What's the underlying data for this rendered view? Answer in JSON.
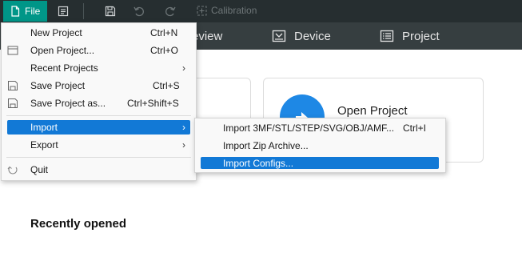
{
  "toolbar": {
    "file_label": "File",
    "calibration_label": "Calibration"
  },
  "tabs": [
    {
      "label": "eview"
    },
    {
      "label": "Device"
    },
    {
      "label": "Project"
    }
  ],
  "home": {
    "open_project_label": "Open Project",
    "recently_opened_label": "Recently opened"
  },
  "file_menu": {
    "items": [
      {
        "label": "New Project",
        "shortcut": "Ctrl+N"
      },
      {
        "label": "Open Project...",
        "shortcut": "Ctrl+O"
      },
      {
        "label": "Recent Projects",
        "shortcut": ""
      },
      {
        "label": "Save Project",
        "shortcut": "Ctrl+S"
      },
      {
        "label": "Save Project as...",
        "shortcut": "Ctrl+Shift+S"
      },
      {
        "label": "Import",
        "shortcut": ""
      },
      {
        "label": "Export",
        "shortcut": ""
      },
      {
        "label": "Quit",
        "shortcut": ""
      }
    ]
  },
  "import_menu": {
    "items": [
      {
        "label": "Import 3MF/STL/STEP/SVG/OBJ/AMF...",
        "shortcut": "Ctrl+I"
      },
      {
        "label": "Import Zip Archive...",
        "shortcut": ""
      },
      {
        "label": "Import Configs...",
        "shortcut": ""
      }
    ]
  },
  "colors": {
    "accent": "#009688",
    "selection": "#1279d6",
    "topbar": "#262e30",
    "tabsbar": "#363e40"
  }
}
